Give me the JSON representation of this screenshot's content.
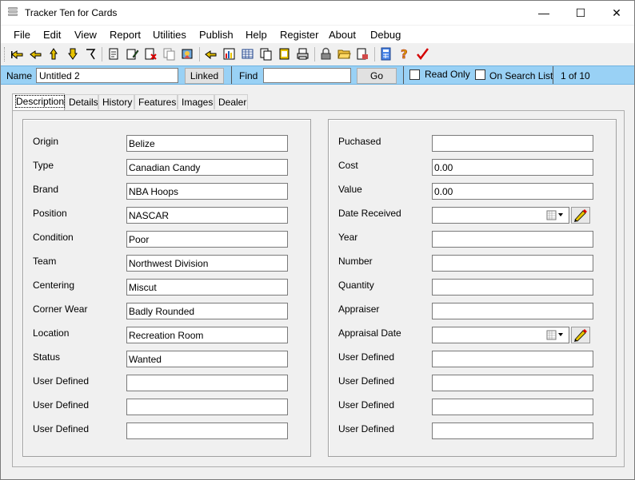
{
  "window": {
    "title": "Tracker Ten for Cards",
    "minimize_glyph": "—",
    "maximize_glyph": "☐",
    "close_glyph": "✕"
  },
  "menu": [
    "File",
    "Edit",
    "View",
    "Report",
    "Utilities",
    "Publish",
    "Help",
    "Register",
    "About",
    "Debug"
  ],
  "toolbar": {
    "icons": [
      "first-record-icon",
      "previous-record-icon",
      "up-record-icon",
      "next-record-icon",
      "last-record-icon",
      "new-record-icon",
      "edit-record-icon",
      "delete-record-icon",
      "copy-record-icon",
      "wizard-icon",
      "list-search-icon",
      "report-icon",
      "table-view-icon",
      "pages-icon",
      "film-icon",
      "print-icon",
      "lock-icon",
      "open-folder-icon",
      "export-icon",
      "calculator-icon",
      "help-icon",
      "checkmark-icon"
    ]
  },
  "namebar": {
    "name_label": "Name",
    "name_value": "Untitled 2",
    "linked_button": "Linked",
    "find_label": "Find",
    "find_value": "",
    "go_button": "Go",
    "read_only_label": "Read Only",
    "on_search_list_label": "On Search List",
    "record_position": "1 of 10"
  },
  "tabs": [
    "Description",
    "Details",
    "History",
    "Features",
    "Images",
    "Dealer"
  ],
  "left_fields": [
    {
      "label": "Origin",
      "value": "Belize"
    },
    {
      "label": "Type",
      "value": "Canadian Candy"
    },
    {
      "label": "Brand",
      "value": "NBA Hoops"
    },
    {
      "label": "Position",
      "value": "NASCAR"
    },
    {
      "label": "Condition",
      "value": "Poor"
    },
    {
      "label": "Team",
      "value": "Northwest Division"
    },
    {
      "label": "Centering",
      "value": "Miscut"
    },
    {
      "label": "Corner Wear",
      "value": "Badly Rounded"
    },
    {
      "label": "Location",
      "value": "Recreation Room"
    },
    {
      "label": "Status",
      "value": "Wanted"
    },
    {
      "label": "User Defined",
      "value": ""
    },
    {
      "label": "User Defined",
      "value": ""
    },
    {
      "label": "User Defined",
      "value": ""
    }
  ],
  "right_fields": [
    {
      "label": "Puchased",
      "value": "",
      "kind": "text"
    },
    {
      "label": "Cost",
      "value": "0.00",
      "kind": "text"
    },
    {
      "label": "Value",
      "value": "0.00",
      "kind": "text"
    },
    {
      "label": "Date Received",
      "value": "",
      "kind": "date"
    },
    {
      "label": "Year",
      "value": "",
      "kind": "text"
    },
    {
      "label": "Number",
      "value": "",
      "kind": "text"
    },
    {
      "label": "Quantity",
      "value": "",
      "kind": "text"
    },
    {
      "label": "Appraiser",
      "value": "",
      "kind": "text"
    },
    {
      "label": "Appraisal Date",
      "value": "",
      "kind": "date"
    },
    {
      "label": "User Defined",
      "value": "",
      "kind": "text"
    },
    {
      "label": "User Defined",
      "value": "",
      "kind": "text"
    },
    {
      "label": "User Defined",
      "value": "",
      "kind": "text"
    },
    {
      "label": "User Defined",
      "value": "",
      "kind": "text"
    }
  ],
  "colors": {
    "namebar_bg": "#99d1f5",
    "checkmark": "#d40000",
    "help": "#d4a000"
  }
}
